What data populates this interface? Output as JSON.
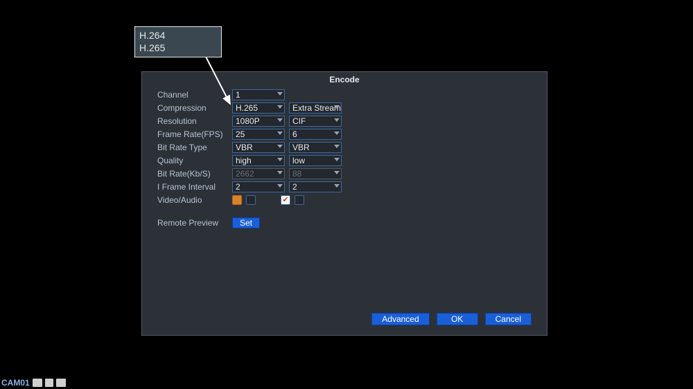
{
  "callout": {
    "opt1": "H.264",
    "opt2": "H.265"
  },
  "dialog": {
    "title": "Encode",
    "labels": {
      "channel": "Channel",
      "compression": "Compression",
      "resolution": "Resolution",
      "framerate": "Frame Rate(FPS)",
      "bitratetype": "Bit Rate Type",
      "quality": "Quality",
      "bitratekbs": "Bit Rate(Kb/S)",
      "iframe": "I Frame Interval",
      "videoaudio": "Video/Audio",
      "remote": "Remote Preview"
    },
    "main": {
      "channel": "1",
      "compression": "H.265",
      "resolution": "1080P",
      "framerate": "25",
      "bitratetype": "VBR",
      "quality": "high",
      "bitratekbs": "2662",
      "iframe": "2"
    },
    "extra": {
      "stream": "Extra Stream",
      "resolution": "CIF",
      "framerate": "6",
      "bitratetype": "VBR",
      "quality": "low",
      "bitratekbs": "88",
      "iframe": "2"
    },
    "buttons": {
      "set": "Set",
      "advanced": "Advanced",
      "ok": "OK",
      "cancel": "Cancel"
    }
  },
  "status": {
    "cam": "CAM01"
  }
}
